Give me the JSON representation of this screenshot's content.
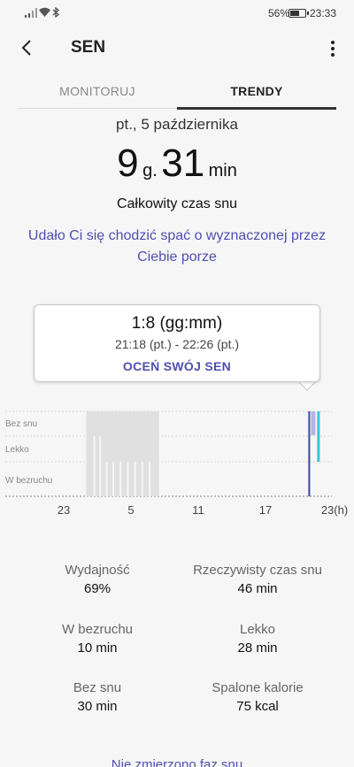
{
  "status": {
    "battery": "56%",
    "time": "23:33"
  },
  "header": {
    "title": "SEN"
  },
  "tabs": [
    {
      "label": "MONITORUJ"
    },
    {
      "label": "TRENDY"
    }
  ],
  "summary": {
    "date": "pt., 5 października",
    "hours": "9",
    "hours_unit": "g.",
    "minutes": "31",
    "minutes_unit": "min",
    "total_label": "Całkowity czas snu",
    "message": "Udało Ci się chodzić spać o wyznaczonej przez Ciebie porze"
  },
  "tooltip": {
    "duration": "1:8 (gg:mm)",
    "range": "21:18 (pt.) - 22:26 (pt.)",
    "rate_label": "OCEŃ SWÓJ SEN"
  },
  "chart_data": {
    "type": "bar",
    "levels": [
      "Bez snu",
      "Lekko",
      "W bezruchu"
    ],
    "x_ticks": [
      "23",
      "5",
      "11",
      "17",
      "23(h)"
    ],
    "x_unit": "h",
    "xlim": [
      23,
      47
    ],
    "series": [
      {
        "start": 25.0,
        "end": 31.5,
        "level": "Bez snu"
      },
      {
        "start": 44.9,
        "end": 46.1,
        "level": "Bez snu"
      }
    ],
    "colors": {
      "sleep_grey": "#e0e0e0",
      "selection": "#3a4a9e",
      "light": "#b7b3e6",
      "awake": "#3cc6d6"
    }
  },
  "stats": [
    {
      "label": "Wydajność",
      "value": "69%"
    },
    {
      "label": "Rzeczywisty czas snu",
      "value": "46 min"
    },
    {
      "label": "W bezruchu",
      "value": "10 min"
    },
    {
      "label": "Lekko",
      "value": "28 min"
    },
    {
      "label": "Bez snu",
      "value": "30 min"
    },
    {
      "label": "Spalone kalorie",
      "value": "75 kcal"
    }
  ],
  "bottom_link": "Nie zmierzono faz snu"
}
